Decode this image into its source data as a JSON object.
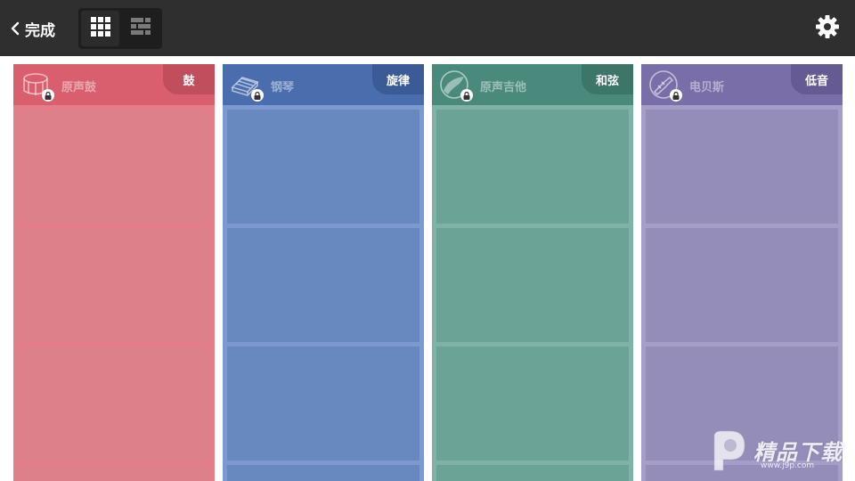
{
  "toolbar": {
    "done_label": "完成",
    "back_icon": "chevron-left-icon",
    "view_modes": [
      {
        "name": "grid-view",
        "icon": "grid-icon",
        "active": true
      },
      {
        "name": "list-view",
        "icon": "list-icon",
        "active": false
      }
    ],
    "settings_icon": "gear-icon"
  },
  "columns": [
    {
      "name": "原声鼓",
      "tag": "鼓",
      "icon": "drum-icon",
      "locked": true,
      "colors": {
        "header": "#d95f6e",
        "tag": "#c04e5d",
        "body": "#e47d89",
        "slot": "#dd808a"
      }
    },
    {
      "name": "钢琴",
      "tag": "旋律",
      "icon": "piano-icon",
      "locked": true,
      "colors": {
        "header": "#4a6ead",
        "tag": "#3a5b96",
        "body": "#7c9ad0",
        "slot": "#6789c0"
      }
    },
    {
      "name": "原声吉他",
      "tag": "和弦",
      "icon": "guitar-icon",
      "locked": true,
      "colors": {
        "header": "#4a8a7c",
        "tag": "#3b7669",
        "body": "#7fb3a8",
        "slot": "#6ba396"
      }
    },
    {
      "name": "电贝斯",
      "tag": "低音",
      "icon": "bass-guitar-icon",
      "locked": true,
      "colors": {
        "header": "#7a6ea8",
        "tag": "#665a92",
        "body": "#a69ec8",
        "slot": "#958db9"
      }
    }
  ],
  "watermark": {
    "text": "精品下载",
    "url": "www.j9p.com",
    "icon": "p-logo-icon"
  }
}
